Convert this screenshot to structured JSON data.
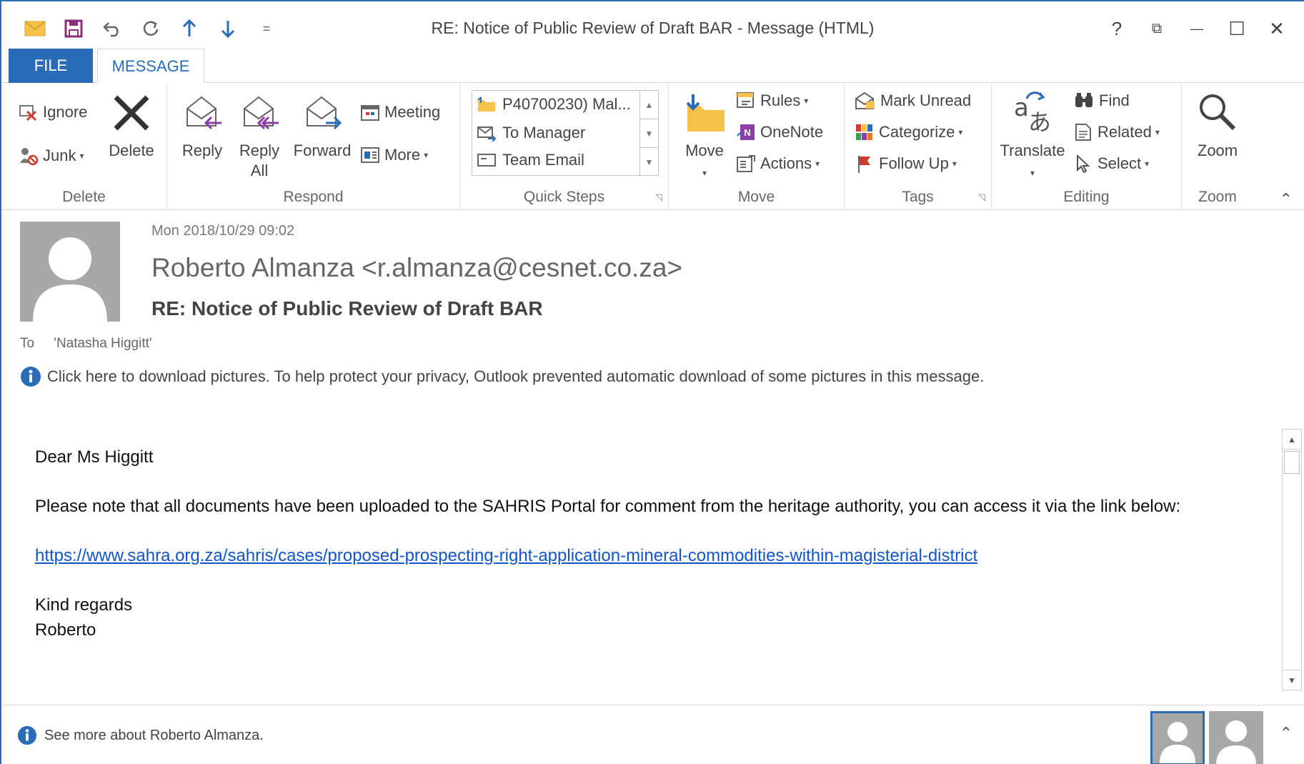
{
  "window": {
    "title": "RE: Notice of Public Review of Draft BAR - Message (HTML)",
    "controls": {
      "help": "?",
      "restore_ribbon": "⧉",
      "minimize": "—",
      "maximize": "☐",
      "close": "✕"
    }
  },
  "qat": {
    "customize": "="
  },
  "tabs": {
    "file": "FILE",
    "message": "MESSAGE"
  },
  "ribbon": {
    "delete_group": {
      "label": "Delete",
      "ignore": "Ignore",
      "junk": "Junk",
      "delete": "Delete"
    },
    "respond_group": {
      "label": "Respond",
      "reply": "Reply",
      "reply_all_1": "Reply",
      "reply_all_2": "All",
      "forward": "Forward",
      "meeting": "Meeting",
      "more": "More"
    },
    "quicksteps_group": {
      "label": "Quick Steps",
      "items": [
        "P40700230) Mal...",
        "To Manager",
        "Team Email"
      ]
    },
    "move_group": {
      "label": "Move",
      "move": "Move",
      "rules": "Rules",
      "onenote": "OneNote",
      "actions": "Actions"
    },
    "tags_group": {
      "label": "Tags",
      "mark_unread": "Mark Unread",
      "categorize": "Categorize",
      "follow_up": "Follow Up"
    },
    "editing_group": {
      "label": "Editing",
      "translate": "Translate",
      "find": "Find",
      "related": "Related",
      "select": "Select"
    },
    "zoom_group": {
      "label": "Zoom",
      "zoom": "Zoom"
    }
  },
  "message": {
    "date": "Mon 2018/10/29 09:02",
    "sender": "Roberto Almanza <r.almanza@cesnet.co.za>",
    "subject": "RE: Notice of Public Review of Draft BAR",
    "to_label": "To",
    "to_value": "'Natasha Higgitt'",
    "notice": "Click here to download pictures. To help protect your privacy, Outlook prevented automatic download of some pictures in this message.",
    "body": {
      "greeting": "Dear Ms Higgitt",
      "paragraph": "Please note that all documents have been uploaded to the SAHRIS Portal for comment from the heritage authority, you can access it via the link below:",
      "link": "https://www.sahra.org.za/sahris/cases/proposed-prospecting-right-application-mineral-commodities-within-magisterial-district",
      "closing": "Kind regards",
      "signature": "Roberto"
    }
  },
  "people_pane": {
    "text": "See more about Roberto Almanza."
  },
  "colors": {
    "accent": "#2b6cb8",
    "link": "#1155cc",
    "avatar": "#a8a8a8"
  }
}
